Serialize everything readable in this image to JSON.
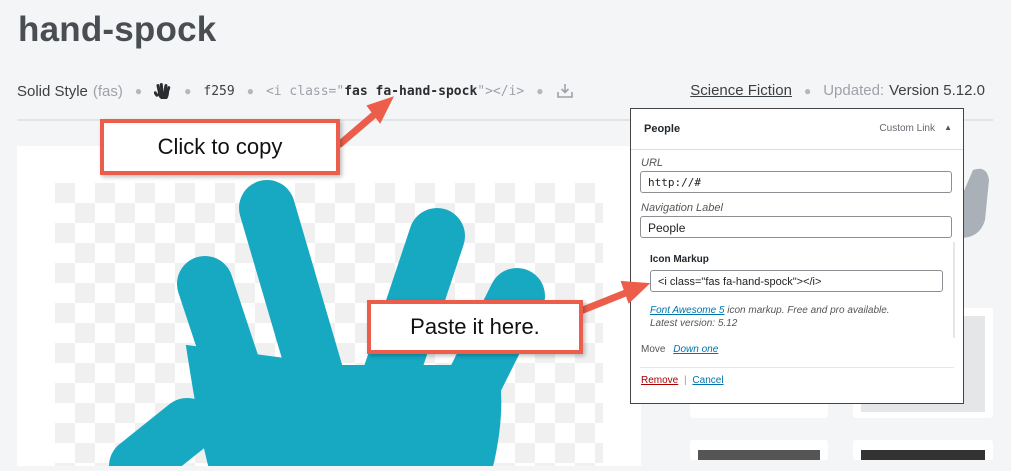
{
  "page": {
    "title": "hand-spock",
    "style_label": "Solid Style",
    "style_prefix": "(fas)",
    "unicode": "f259",
    "markup_prefix": "<i class=\"",
    "markup_class": "fas fa-hand-spock",
    "markup_suffix": "\"></i>",
    "category_link": "Science Fiction",
    "updated_label": "Updated:",
    "version": "Version 5.12.0",
    "icon_color": "#17a9c2"
  },
  "callouts": {
    "copy": "Click to copy",
    "paste": "Paste it here."
  },
  "menu_item": {
    "title": "People",
    "type": "Custom Link",
    "url_label": "URL",
    "url_value": "http://#",
    "nav_label": "Navigation Label",
    "nav_value": "People",
    "icon_markup_label": "Icon Markup",
    "icon_markup_value": "<i class=\"fas fa-hand-spock\"></i>",
    "fa_link": "Font Awesome 5",
    "fa_desc": " icon markup. Free and pro available.",
    "latest": "Latest version: 5.12",
    "move_label": "Move",
    "move_link": "Down one",
    "remove_link": "Remove",
    "separator": "|",
    "cancel_link": "Cancel"
  },
  "colors": {
    "accent": "#ec5e4b",
    "link": "#0073aa",
    "remove": "#aa0000"
  }
}
